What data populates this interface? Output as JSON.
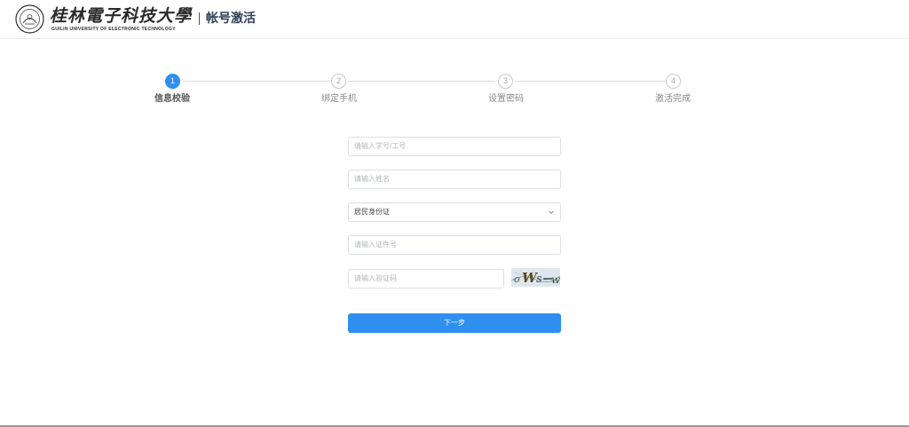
{
  "header": {
    "university_name": "桂林電子科技大學",
    "university_en": "GUILIN UNIVERSITY OF ELECTRONIC TECHNOLOGY",
    "page_title": "帐号激活",
    "seal_icon": "university-seal-icon"
  },
  "steps": [
    {
      "number": "1",
      "label": "信息校验",
      "active": true
    },
    {
      "number": "2",
      "label": "绑定手机",
      "active": false
    },
    {
      "number": "3",
      "label": "设置密码",
      "active": false
    },
    {
      "number": "4",
      "label": "激活完成",
      "active": false
    }
  ],
  "form": {
    "student_id_placeholder": "请输入学号/工号",
    "name_placeholder": "请输入姓名",
    "id_type_value": "居民身份证",
    "id_number_placeholder": "请输入证件号",
    "captcha_placeholder": "请输入验证码",
    "captcha_text": "oWsw",
    "next_label": "下一步"
  },
  "colors": {
    "accent": "#2e8ff0",
    "border": "#dcdfe6"
  }
}
